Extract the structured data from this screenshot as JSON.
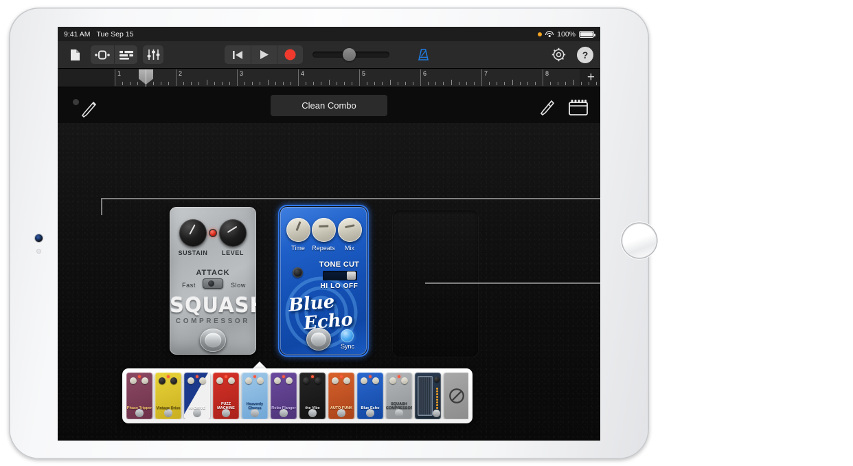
{
  "status_bar": {
    "time": "9:41 AM",
    "date": "Tue Sep 15",
    "battery_percent": "100%",
    "wifi_icon": "wifi-icon",
    "battery_icon": "battery-icon",
    "location_icon": "location-dot-icon"
  },
  "toolbar": {
    "left_buttons": [
      {
        "name": "my-songs-button",
        "icon": "document-icon",
        "label": ""
      },
      {
        "name": "track-view-button",
        "icon": "instrument-view-icon",
        "label": ""
      },
      {
        "name": "tracks-view-button",
        "icon": "tracks-list-icon",
        "label": ""
      },
      {
        "name": "mixer-button",
        "icon": "faders-icon",
        "label": ""
      }
    ],
    "transport": [
      {
        "name": "rewind-button",
        "icon": "rewind-icon"
      },
      {
        "name": "play-button",
        "icon": "play-icon"
      },
      {
        "name": "record-button",
        "icon": "record-icon"
      }
    ],
    "master_volume": {
      "name": "master-volume-slider",
      "value": 40
    },
    "metronome": {
      "name": "metronome-button",
      "icon": "metronome-icon",
      "color": "#1f7ae0"
    },
    "settings": {
      "name": "settings-button",
      "icon": "gear-icon"
    },
    "help": {
      "name": "help-button",
      "icon": "question-mark-icon",
      "label": "?"
    }
  },
  "ruler": {
    "bar_numbers": [
      "1",
      "2",
      "3",
      "4",
      "5",
      "6",
      "7",
      "8"
    ],
    "add_section_label": "+",
    "playhead_position_bar": "1"
  },
  "pedalboard_header": {
    "patch_name": "Clean Combo",
    "left_icon": "guitar-cable-icon",
    "tuner_icon": "tuner-icon",
    "amp_icon": "amp-icon"
  },
  "pedals": [
    {
      "id": "squash",
      "name": "SQUASH",
      "subtitle": "COMPRESSOR",
      "selected": false,
      "controls": [
        {
          "name": "sustain-knob",
          "label": "SUSTAIN",
          "type": "knob"
        },
        {
          "name": "level-knob",
          "label": "LEVEL",
          "type": "knob"
        },
        {
          "name": "attack-switch",
          "label": "ATTACK",
          "type": "toggle",
          "options": [
            "Fast",
            "Slow"
          ]
        },
        {
          "name": "squash-footswitch",
          "label": "",
          "type": "footswitch"
        }
      ]
    },
    {
      "id": "blue-echo",
      "name": "Blue Echo",
      "word_top": "Blue",
      "word_bottom": "Echo",
      "selected": true,
      "controls": [
        {
          "name": "time-knob",
          "label": "Time",
          "type": "knob"
        },
        {
          "name": "repeats-knob",
          "label": "Repeats",
          "type": "knob"
        },
        {
          "name": "mix-knob",
          "label": "Mix",
          "type": "knob"
        },
        {
          "name": "tone-cut-slider",
          "label": "TONE CUT",
          "type": "slider",
          "options_label": "HI LO OFF"
        },
        {
          "name": "blue-echo-footswitch",
          "label": "",
          "type": "footswitch"
        },
        {
          "name": "sync-button",
          "label": "Sync",
          "type": "led-button"
        }
      ]
    },
    {
      "id": "empty-slot",
      "name": "Empty pedal slot",
      "selected": false,
      "controls": []
    }
  ],
  "browser": {
    "items": [
      {
        "name": "browser-pedal-phase-tripper",
        "label": "Phase\nTripper",
        "color": "#8c4a64",
        "color2": "#6d3049",
        "label_color": "#f2c46a"
      },
      {
        "name": "browser-pedal-vintage-drive",
        "label": "Vintage\nDrive",
        "color": "#e8d43a",
        "color2": "#c9ae1f",
        "label_color": "#6c5a0e"
      },
      {
        "name": "browser-pedal-hi-drive",
        "label": "HI-DRIVE",
        "color": "#1b3a8c",
        "color2": "#c2242e",
        "label_color": "#ffffff"
      },
      {
        "name": "browser-pedal-fuzz-machine",
        "label": "FUZZ\nMACHINE",
        "color": "#d63228",
        "color2": "#a9211a",
        "label_color": "#ffffff"
      },
      {
        "name": "browser-pedal-heavenly-chorus",
        "label": "Heavenly\nChorus",
        "color": "#9fc8e8",
        "color2": "#6fa6d6",
        "label_color": "#17407c"
      },
      {
        "name": "browser-pedal-robo-flanger",
        "label": "Robo\nFlanger",
        "color": "#6b4a9e",
        "color2": "#4e3378",
        "label_color": "#cbb9ef"
      },
      {
        "name": "browser-pedal-the-vibe",
        "label": "the\nVibe",
        "color": "#262626",
        "color2": "#121212",
        "label_color": "#e8e8e8"
      },
      {
        "name": "browser-pedal-auto-funk",
        "label": "AUTO\nFUNK",
        "color": "#d9622c",
        "color2": "#a8431a",
        "label_color": "#ffe1b0"
      },
      {
        "name": "browser-pedal-blue-echo",
        "label": "Blue\nEcho",
        "color": "#2a68d0",
        "color2": "#1247a0",
        "label_color": "#ffffff"
      },
      {
        "name": "browser-pedal-squash-compressor",
        "label": "SQUASH\nCOMPRESSOR",
        "color": "#b3b7ba",
        "color2": "#8e9295",
        "label_color": "#343739"
      },
      {
        "name": "browser-pedal-bass-amp",
        "label": "",
        "color": "#2c3c52",
        "color2": "#1a2633",
        "label_color": "#cfd8e2"
      },
      {
        "name": "browser-pedal-none",
        "label": "",
        "color": "#a8a8a8",
        "color2": "#8c8c8c",
        "label_color": "#4a4a4a",
        "icon": "no-pedal-icon"
      }
    ]
  },
  "callouts": [
    {
      "name": "callout-line-knob",
      "target": "repeats-knob"
    },
    {
      "name": "callout-line-slot",
      "target": "empty-slot"
    }
  ]
}
